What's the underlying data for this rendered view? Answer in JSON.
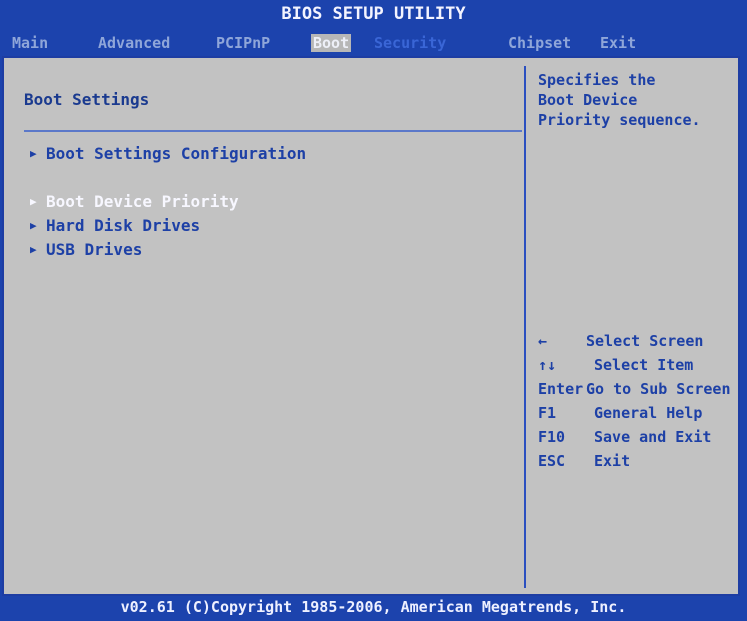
{
  "title": "BIOS SETUP UTILITY",
  "menu": {
    "items": [
      {
        "label": "Main"
      },
      {
        "label": "Advanced"
      },
      {
        "label": "PCIPnP"
      },
      {
        "label": "Boot"
      },
      {
        "label": "Security"
      },
      {
        "label": "Chipset"
      },
      {
        "label": "Exit"
      }
    ],
    "selected": "Boot"
  },
  "left": {
    "section_title": "Boot Settings",
    "items": [
      {
        "label": "Boot Settings Configuration"
      },
      {
        "label": "Boot Device Priority"
      },
      {
        "label": "Hard Disk Drives"
      },
      {
        "label": "USB Drives"
      }
    ],
    "highlighted": "Boot Device Priority"
  },
  "help": {
    "line1": "Specifies the",
    "line2": "Boot Device",
    "line3": "Priority sequence."
  },
  "keys": [
    {
      "key": "←",
      "desc": "Select Screen"
    },
    {
      "key": "↑↓",
      "desc": "Select Item"
    },
    {
      "key": "Enter",
      "desc": "Go to Sub Screen"
    },
    {
      "key": "F1",
      "desc": "General Help"
    },
    {
      "key": "F10",
      "desc": "Save and Exit"
    },
    {
      "key": "ESC",
      "desc": "Exit"
    }
  ],
  "footer": "v02.61 (C)Copyright 1985-2006, American Megatrends, Inc.",
  "colors": {
    "background": "#1c43ad",
    "panel": "#c2c2c2",
    "text_blue": "#1d40a6",
    "text_white": "#f7f7ff",
    "menu_dim": "#8fa6d9"
  }
}
